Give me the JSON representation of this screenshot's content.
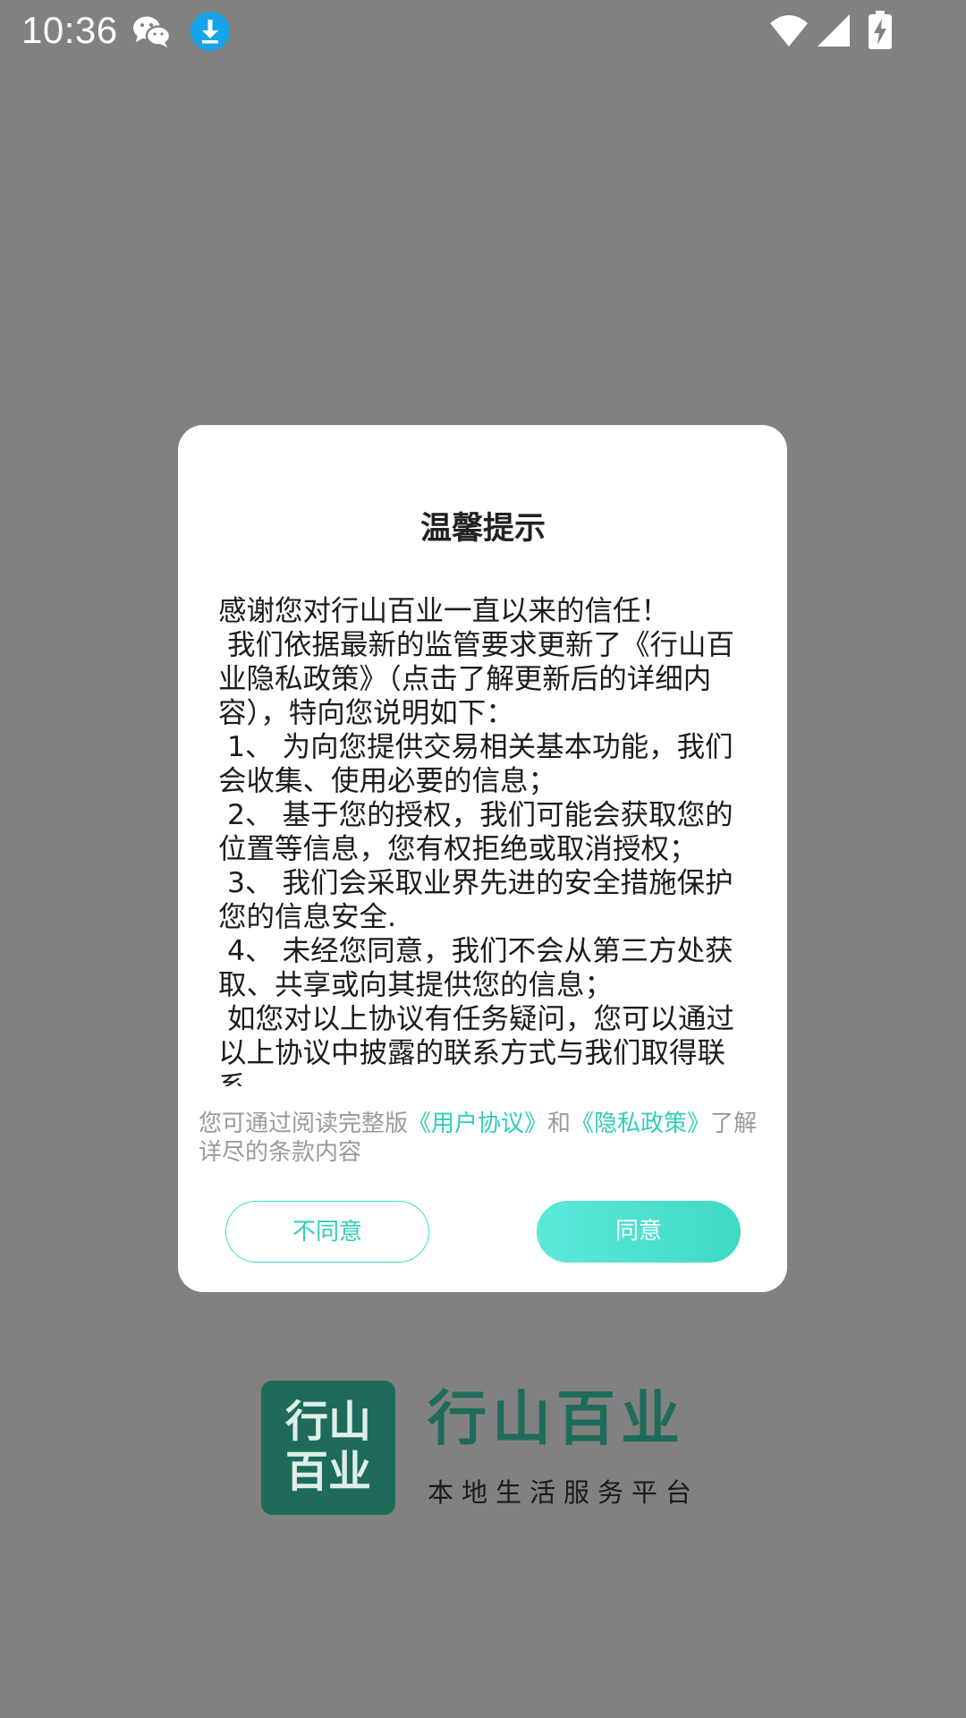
{
  "status_bar": {
    "time": "10:36",
    "icons": [
      "wechat-icon",
      "download-icon",
      "wifi-icon",
      "signal-icon",
      "battery-charging-icon"
    ]
  },
  "dialog": {
    "title": "温馨提示",
    "paragraphs": [
      "感谢您对行山百业一直以来的信任！",
      " 我们依据最新的监管要求更新了《行山百业隐私政策》（点击了解更新后的详细内容），特向您说明如下：",
      " 1、 为向您提供交易相关基本功能，我们会收集、使用必要的信息；",
      " 2、 基于您的授权，我们可能会获取您的位置等信息，您有权拒绝或取消授权；",
      " 3、 我们会采取业界先进的安全措施保护您的信息安全.",
      " 4、 未经您同意，我们不会从第三方处获取、共享或向其提供您的信息；",
      " 如您对以上协议有任务疑问，您可以通过以上协议中披露的联系方式与我们取得联系"
    ],
    "note_prefix": "您可通过阅读完整版",
    "user_agreement_link": "《用户协议》",
    "note_and": "和",
    "privacy_policy_link": "《隐私政策》",
    "note_suffix": "了解详尽的条款内容",
    "disagree_label": "不同意",
    "agree_label": "同意"
  },
  "logo": {
    "square_line1": "行山",
    "square_line2": "百业",
    "name": "行山百业",
    "slogan": "本地生活服务平台"
  },
  "colors": {
    "overlay_background": "#818181",
    "accent": "#2fcfb9",
    "brand": "#1f6b5b"
  }
}
